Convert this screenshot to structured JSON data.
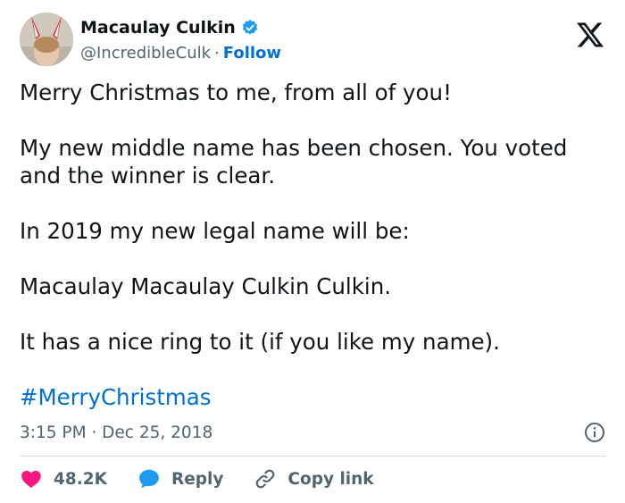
{
  "author": {
    "display_name": "Macaulay Culkin",
    "handle": "@IncredibleCulk",
    "separator": "·",
    "follow_label": "Follow"
  },
  "tweet": {
    "paragraphs": [
      "Merry Christmas to me, from all of you!",
      "My new middle name has been chosen. You voted and the winner is clear.",
      "In 2019 my new legal name will be:",
      "Macaulay Macaulay Culkin Culkin.",
      "It has a nice ring to it (if you like my name)."
    ],
    "hashtag": "#MerryChristmas",
    "timestamp": "3:15 PM · Dec 25, 2018"
  },
  "actions": {
    "likes_count": "48.2K",
    "reply_label": "Reply",
    "copy_link_label": "Copy link"
  },
  "icons": {
    "brand": "x-logo-icon",
    "verified": "verified-badge-icon",
    "info": "info-icon",
    "like": "heart-icon",
    "reply": "speech-bubble-icon",
    "copy": "link-icon"
  },
  "colors": {
    "link": "#006fd6",
    "verified": "#1d9bf0",
    "like": "#f91880",
    "secondary_text": "#536471",
    "primary_text": "#0f1419",
    "divider": "#cfd9de"
  }
}
